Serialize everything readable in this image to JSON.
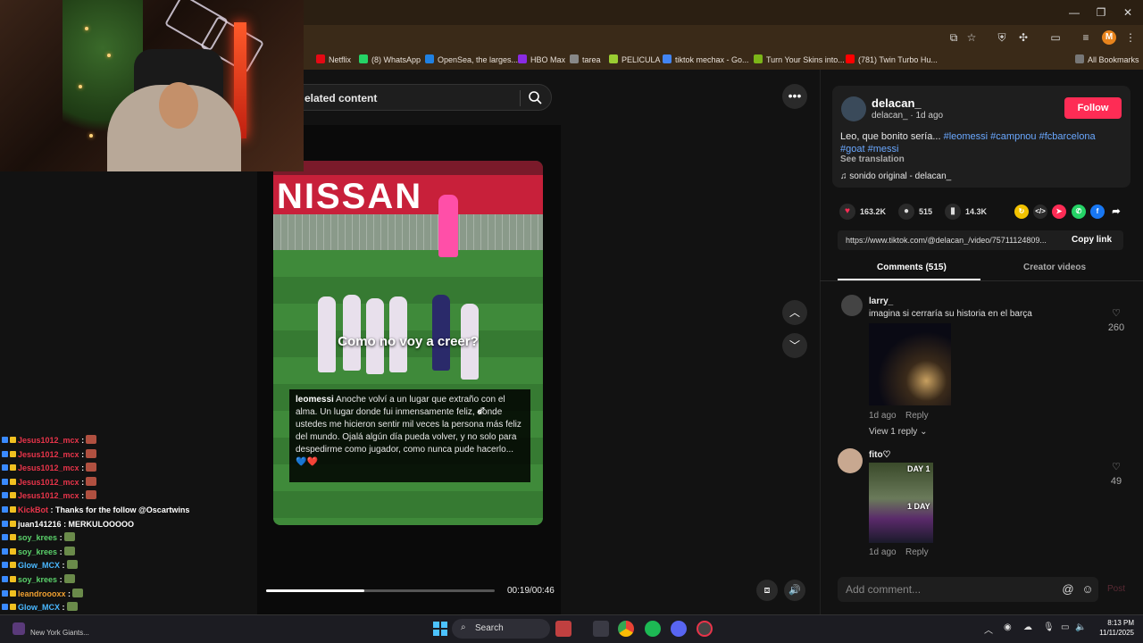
{
  "window_controls": {
    "minimize": "—",
    "restore": "❐",
    "close": "✕"
  },
  "profile_initial": "M",
  "bookmarks": [
    {
      "label": "Netflix",
      "color": "#e50914"
    },
    {
      "label": "(8) WhatsApp",
      "color": "#25d366"
    },
    {
      "label": "OpenSea, the larges...",
      "color": "#2081e2"
    },
    {
      "label": "HBO Max",
      "color": "#8a2be2"
    },
    {
      "label": "tarea",
      "color": "#888888"
    },
    {
      "label": "PELICULA",
      "color": "#9acd32"
    },
    {
      "label": "tiktok mechax - Go...",
      "color": "#4285f4"
    },
    {
      "label": "Turn Your Skins into...",
      "color": "#7cb518"
    },
    {
      "label": "(781) Twin Turbo Hu...",
      "color": "#ff0000"
    }
  ],
  "all_bookmarks": "All Bookmarks",
  "search": {
    "text": "elated content"
  },
  "video": {
    "banner": "NISSAN",
    "caption": "Como no voy a creer?",
    "post_user": "leomessi",
    "post_text": "Anoche volví a un lugar que extraño con el alma. Un lugar donde fui inmensamente feliz, donde ustedes me hicieron sentir mil veces la persona más feliz del mundo. Ojalá algún día pueda volver, y no solo para despedirme como jugador, como nunca pude hacerlo...",
    "post_hearts": "💙❤️",
    "time": "00:19/00:46",
    "progress": 0.43
  },
  "author": {
    "name": "delacan_",
    "meta": "delacan_ · 1d ago",
    "follow": "Follow",
    "description_text": "Leo, que bonito sería... ",
    "tags_line1": "#leomessi #campnou #fcbarcelona",
    "tags_line2": "#goat #messi",
    "see_translation": "See translation",
    "sound": "♫  sonido original - delacan_"
  },
  "stats": {
    "likes": "163.2K",
    "comments": "515",
    "saves": "14.3K"
  },
  "share_link": {
    "url": "https://www.tiktok.com/@delacan_/video/75711124809...",
    "copy": "Copy link"
  },
  "tabs": {
    "comments": "Comments (515)",
    "creator": "Creator videos"
  },
  "comments": [
    {
      "user": "larry_",
      "text": "imagina si cerraría su historia en el barça",
      "meta": "1d ago",
      "reply": "Reply",
      "likes": "260",
      "replies": "View 1 reply ⌄"
    },
    {
      "user": "fito♡",
      "text": "",
      "meta": "1d ago",
      "reply": "Reply",
      "likes": "49",
      "img_top": "DAY 1",
      "img_mid": "1 DAY"
    }
  ],
  "comment_input": {
    "placeholder": "Add comment...",
    "post": "Post"
  },
  "chat": [
    {
      "user": "Jesus1012_mcx",
      "msg": ":",
      "color": "#e8344a",
      "emote": true
    },
    {
      "user": "Jesus1012_mcx",
      "msg": ":",
      "color": "#e8344a",
      "emote": true
    },
    {
      "user": "Jesus1012_mcx",
      "msg": ":",
      "color": "#e8344a",
      "emote": true
    },
    {
      "user": "Jesus1012_mcx",
      "msg": ":",
      "color": "#e8344a",
      "emote": true
    },
    {
      "user": "Jesus1012_mcx",
      "msg": ":",
      "color": "#e8344a",
      "emote": true
    },
    {
      "user": "KickBot",
      "msg": ": Thanks for the follow @Oscartwins",
      "color": "#e8344a",
      "emote": false
    },
    {
      "user": "juan141216",
      "msg": ": MERKULOOOOO",
      "color": "#ffffff",
      "emote": false
    },
    {
      "user": "soy_krees",
      "msg": ":",
      "color": "#5ad06a",
      "emote": true
    },
    {
      "user": "soy_krees",
      "msg": ":",
      "color": "#5ad06a",
      "emote": true
    },
    {
      "user": "Glow_MCX",
      "msg": ":",
      "color": "#4ab8ff",
      "emote": true
    },
    {
      "user": "soy_krees",
      "msg": ":",
      "color": "#5ad06a",
      "emote": true
    },
    {
      "user": "leandroooxx",
      "msg": ":",
      "color": "#f0a030",
      "emote": true
    },
    {
      "user": "Glow_MCX",
      "msg": ":",
      "color": "#4ab8ff",
      "emote": true
    },
    {
      "user": "Glow_MCX",
      "msg": ":",
      "color": "#4ab8ff",
      "emote": true
    }
  ],
  "taskbar": {
    "search": "Search",
    "news": "New York Giants...",
    "time": "8:13 PM",
    "date": "11/11/2025"
  }
}
